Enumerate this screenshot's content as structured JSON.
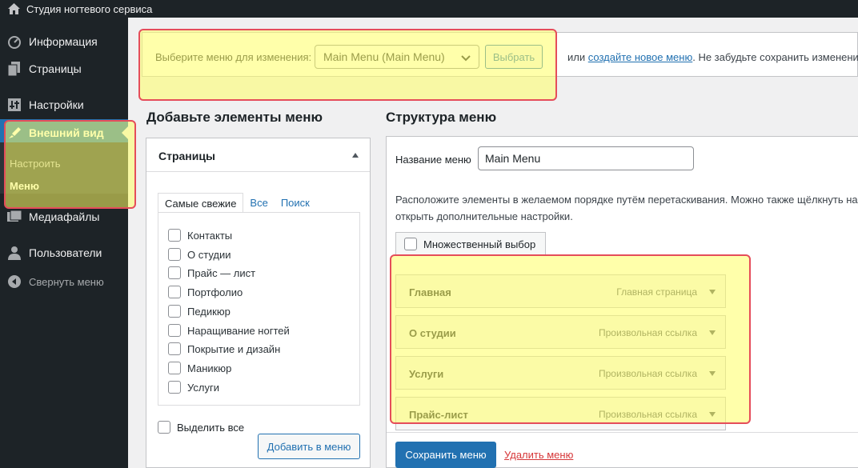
{
  "adminbar": {
    "site_title": "Студия ногтевого сервиса"
  },
  "sidebar": {
    "items": [
      {
        "label": "Информация",
        "icon": "dashboard-icon"
      },
      {
        "label": "Страницы",
        "icon": "pages-icon"
      },
      {
        "label": "Настройки",
        "icon": "settings-icon"
      },
      {
        "label": "Внешний вид",
        "icon": "appearance-icon"
      },
      {
        "label": "Медиафайлы",
        "icon": "media-icon"
      },
      {
        "label": "Пользователи",
        "icon": "users-icon"
      }
    ],
    "submenu": [
      {
        "label": "Настроить"
      },
      {
        "label": "Меню"
      }
    ],
    "collapse_label": "Свернуть меню"
  },
  "manage": {
    "label": "Выберите меню для изменения:",
    "selected_menu": "Main Menu (Main Menu)",
    "select_button": "Выбрать",
    "or_text": "или",
    "create_link": "создайте новое меню",
    "save_reminder": ". Не забудьте сохранить изменения!"
  },
  "add_items": {
    "heading": "Добавьте элементы меню",
    "panel_title": "Страницы",
    "tabs": [
      "Самые свежие",
      "Все",
      "Поиск"
    ],
    "pages": [
      "Контакты",
      "О студии",
      "Прайс — лист",
      "Портфолио",
      "Педикюр",
      "Наращивание ногтей",
      "Покрытие и дизайн",
      "Маникюр",
      "Услуги"
    ],
    "select_all": "Выделить все",
    "add_button": "Добавить в меню"
  },
  "structure": {
    "heading": "Структура меню",
    "name_label": "Название меню",
    "name_value": "Main Menu",
    "description_line1": "Расположите элементы в желаемом порядке путём перетаскивания. Можно также щёлкнуть на",
    "description_line2": "открыть дополнительные настройки.",
    "bulk_select": "Множественный выбор",
    "menu_items": [
      {
        "title": "Главная",
        "type": "Главная страница"
      },
      {
        "title": "О студии",
        "type": "Произвольная ссылка"
      },
      {
        "title": "Услуги",
        "type": "Произвольная ссылка"
      },
      {
        "title": "Прайс-лист",
        "type": "Произвольная ссылка"
      }
    ],
    "save_button": "Сохранить меню",
    "delete_link": "Удалить меню"
  },
  "colors": {
    "accent": "#2271b1",
    "sidebar_bg": "#1d2327",
    "highlight_fill": "#ffff64",
    "highlight_border": "#e54d5a",
    "danger": "#d63638"
  }
}
